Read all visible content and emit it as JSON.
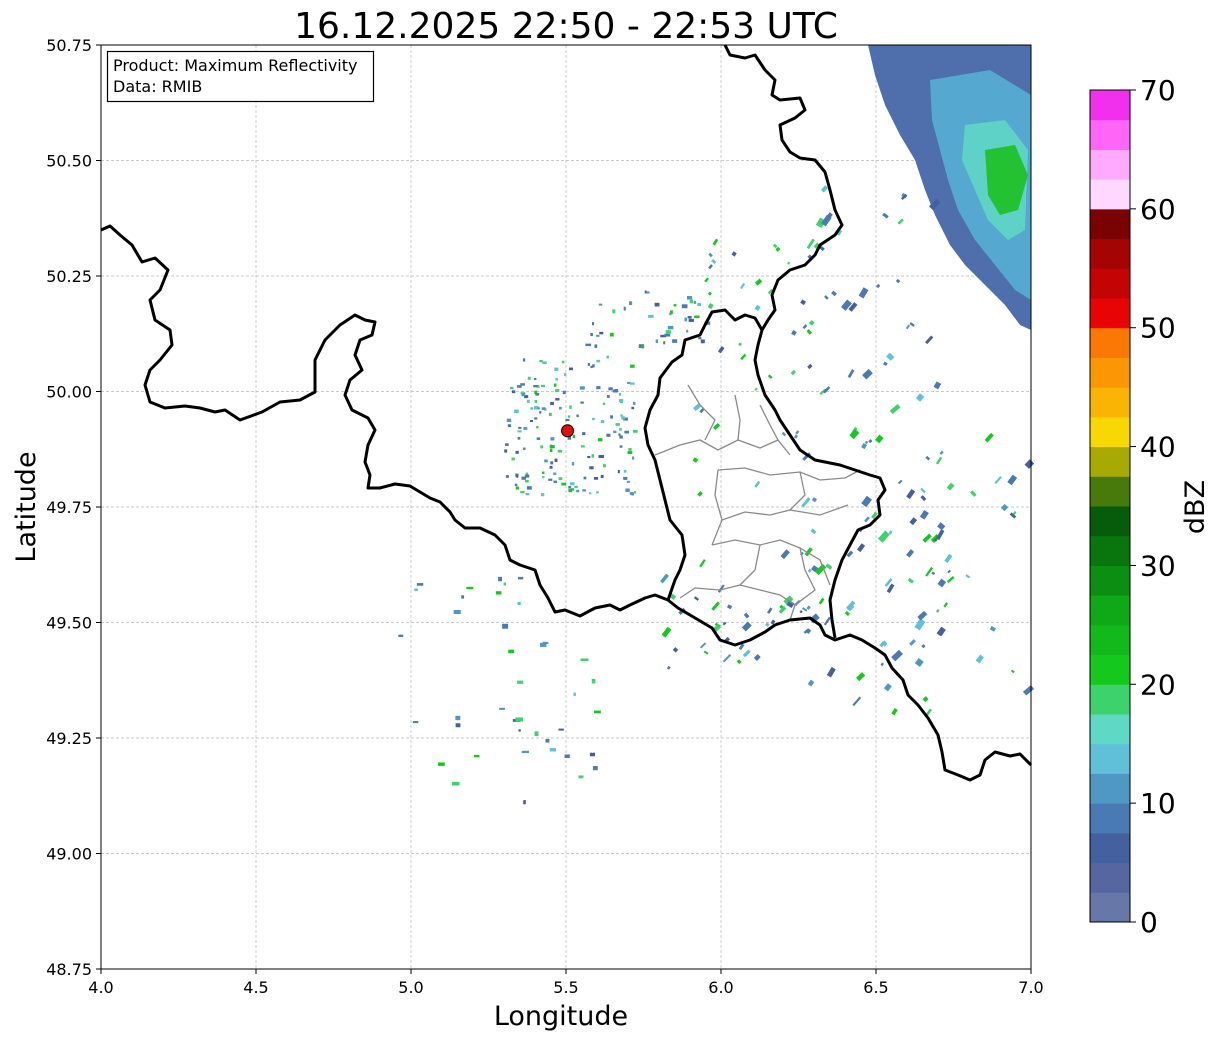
{
  "title": "16.12.2025 22:50 - 22:53 UTC",
  "info_box": {
    "product": "Product: Maximum Reflectivity",
    "data": "Data: RMIB"
  },
  "chart_data": {
    "type": "heatmap",
    "title": "16.12.2025 22:50 - 22:53 UTC",
    "xlabel": "Longitude",
    "ylabel": "Latitude",
    "xlim": [
      4.0,
      7.0
    ],
    "ylim": [
      48.75,
      50.75
    ],
    "x_ticks": [
      "4.0",
      "4.5",
      "5.0",
      "5.5",
      "6.0",
      "6.5",
      "7.0"
    ],
    "y_ticks": [
      "48.75",
      "49.00",
      "49.25",
      "49.50",
      "49.75",
      "50.00",
      "50.25",
      "50.50",
      "50.75"
    ],
    "grid": true,
    "radar_site": {
      "lon": 5.505,
      "lat": 49.915,
      "color": "#e01010"
    },
    "colorbar": {
      "label": "dBZ",
      "min": 0,
      "max": 70,
      "ticks": [
        "0",
        "10",
        "20",
        "30",
        "40",
        "50",
        "60",
        "70"
      ],
      "colors": [
        "#6677a8",
        "#5566a0",
        "#45609e",
        "#4a7ab4",
        "#4f98c4",
        "#5fc0d8",
        "#5fd8c4",
        "#3ed26c",
        "#15c81e",
        "#13b81a",
        "#0fa817",
        "#0b8e12",
        "#08750d",
        "#065c0a",
        "#477a0a",
        "#a8aa04",
        "#f8d804",
        "#fab404",
        "#fc9604",
        "#fc7804",
        "#e80404",
        "#c40404",
        "#a40404",
        "#7a0202",
        "#ffd8ff",
        "#ffaaff",
        "#ff66f8",
        "#f030ec"
      ]
    },
    "echo_regions": [
      {
        "name": "northeast-rain-band",
        "dbz_range": [
          0,
          25
        ],
        "lon_range": [
          6.45,
          7.0
        ],
        "lat_range": [
          50.12,
          50.75
        ]
      },
      {
        "name": "scattered-echoes-east",
        "dbz_range": [
          5,
          25
        ],
        "lon_range": [
          5.9,
          7.0
        ],
        "lat_range": [
          49.4,
          50.5
        ]
      },
      {
        "name": "ground-clutter-near-radar",
        "dbz_range": [
          0,
          10
        ],
        "lon_range": [
          5.3,
          5.7
        ],
        "lat_range": [
          49.8,
          50.1
        ]
      }
    ],
    "boundaries": [
      "national borders (thick black)",
      "Luxembourg cantons (grey)"
    ]
  }
}
